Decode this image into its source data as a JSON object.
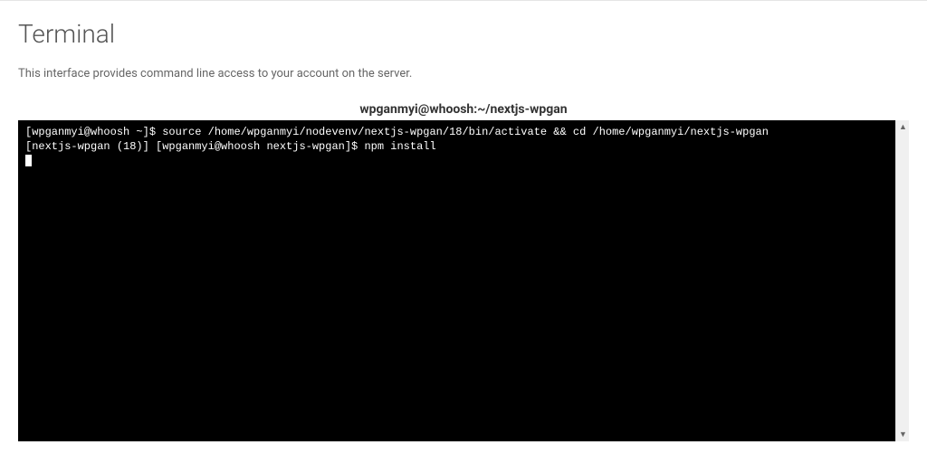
{
  "header": {
    "title": "Terminal",
    "description": "This interface provides command line access to your account on the server."
  },
  "terminal": {
    "session_label": "wpganmyi@whoosh:~/nextjs-wpgan",
    "lines": [
      "[wpganmyi@whoosh ~]$ source /home/wpganmyi/nodevenv/nextjs-wpgan/18/bin/activate && cd /home/wpganmyi/nextjs-wpgan",
      "[nextjs-wpgan (18)] [wpganmyi@whoosh nextjs-wpgan]$ npm install"
    ]
  }
}
